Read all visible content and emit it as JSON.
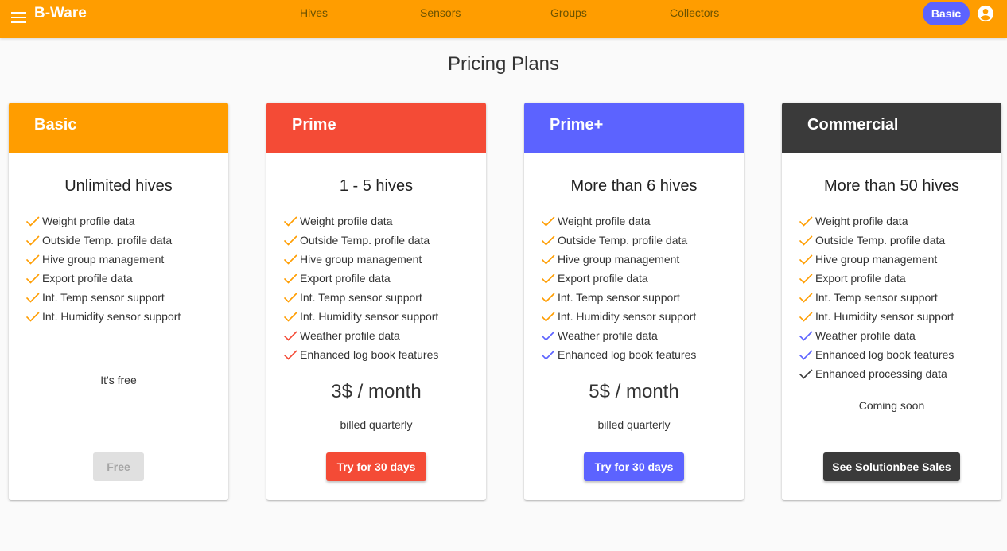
{
  "app": {
    "brand": "B-Ware",
    "nav": [
      "Hives",
      "Sensors",
      "Groups",
      "Collectors"
    ],
    "plan_badge": "Basic",
    "colors": {
      "topbar": "#ff9d00",
      "badge": "#5c63ff"
    },
    "icons": {
      "menu": "menu-icon",
      "account": "account-circle-icon"
    }
  },
  "page": {
    "title": "Pricing Plans"
  },
  "plans": [
    {
      "name": "Basic",
      "subtitle": "Unlimited hives",
      "color": "#ff9d00",
      "features": [
        {
          "label": "Weight profile data",
          "check_color": "#ff9d00"
        },
        {
          "label": "Outside Temp. profile data",
          "check_color": "#ff9d00"
        },
        {
          "label": "Hive group management",
          "check_color": "#ff9d00"
        },
        {
          "label": "Export profile data",
          "check_color": "#ff9d00"
        },
        {
          "label": "Int. Temp sensor support",
          "check_color": "#ff9d00"
        },
        {
          "label": "Int. Humidity sensor support",
          "check_color": "#ff9d00"
        }
      ],
      "price_note": "It's free",
      "button": "Free"
    },
    {
      "name": "Prime",
      "subtitle": "1 - 5 hives",
      "color": "#f44b36",
      "features": [
        {
          "label": "Weight profile data",
          "check_color": "#ff9d00"
        },
        {
          "label": "Outside Temp. profile data",
          "check_color": "#ff9d00"
        },
        {
          "label": "Hive group management",
          "check_color": "#ff9d00"
        },
        {
          "label": "Export profile data",
          "check_color": "#ff9d00"
        },
        {
          "label": "Int. Temp sensor support",
          "check_color": "#ff9d00"
        },
        {
          "label": "Int. Humidity sensor support",
          "check_color": "#ff9d00"
        },
        {
          "label": "Weather profile data",
          "check_color": "#f44b36"
        },
        {
          "label": "Enhanced log book features",
          "check_color": "#f44b36"
        }
      ],
      "price": "3$ / month",
      "billing": "billed quarterly",
      "button": "Try for 30 days"
    },
    {
      "name": "Prime+",
      "subtitle": "More than 6 hives",
      "color": "#5c63ff",
      "features": [
        {
          "label": "Weight profile data",
          "check_color": "#ff9d00"
        },
        {
          "label": "Outside Temp. profile data",
          "check_color": "#ff9d00"
        },
        {
          "label": "Hive group management",
          "check_color": "#ff9d00"
        },
        {
          "label": "Export profile data",
          "check_color": "#ff9d00"
        },
        {
          "label": "Int. Temp sensor support",
          "check_color": "#ff9d00"
        },
        {
          "label": "Int. Humidity sensor support",
          "check_color": "#ff9d00"
        },
        {
          "label": "Weather profile data",
          "check_color": "#5c63ff"
        },
        {
          "label": "Enhanced log book features",
          "check_color": "#5c63ff"
        }
      ],
      "price": "5$ / month",
      "billing": "billed quarterly",
      "button": "Try for 30 days"
    },
    {
      "name": "Commercial",
      "subtitle": "More than 50 hives",
      "color": "#3a3a3a",
      "features": [
        {
          "label": "Weight profile data",
          "check_color": "#ff9d00"
        },
        {
          "label": "Outside Temp. profile data",
          "check_color": "#ff9d00"
        },
        {
          "label": "Hive group management",
          "check_color": "#ff9d00"
        },
        {
          "label": "Export profile data",
          "check_color": "#ff9d00"
        },
        {
          "label": "Int. Temp sensor support",
          "check_color": "#ff9d00"
        },
        {
          "label": "Int. Humidity sensor support",
          "check_color": "#ff9d00"
        },
        {
          "label": "Weather profile data",
          "check_color": "#5c63ff"
        },
        {
          "label": "Enhanced log book features",
          "check_color": "#5c63ff"
        },
        {
          "label": "Enhanced processing data",
          "check_color": "#3a3a3a"
        }
      ],
      "price_note": "Coming soon",
      "button": "See Solutionbee Sales"
    }
  ]
}
